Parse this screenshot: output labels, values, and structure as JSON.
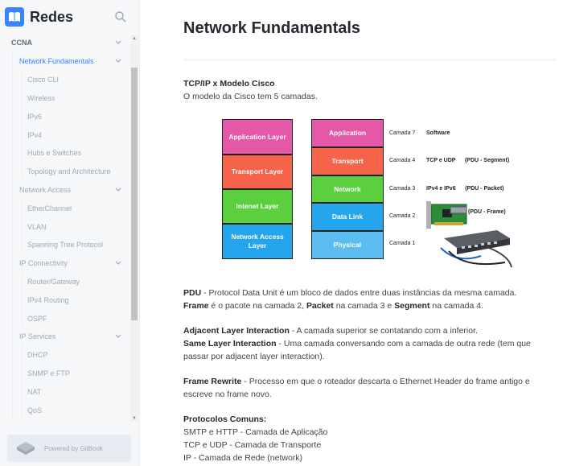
{
  "app": {
    "title": "Redes",
    "logo_icon": "book-icon",
    "accent": "#3884ff"
  },
  "sidebar": {
    "sections": [
      {
        "label": "CCNA",
        "level": 0
      },
      {
        "label": "Network Fundamentals",
        "level": 1,
        "active": true
      },
      {
        "label": "Cisco CLI",
        "level": 2
      },
      {
        "label": "Wireless",
        "level": 2
      },
      {
        "label": "IPv6",
        "level": 2
      },
      {
        "label": "IPv4",
        "level": 2
      },
      {
        "label": "Hubs e Switches",
        "level": 2
      },
      {
        "label": "Topology and Architecture",
        "level": 2
      },
      {
        "label": "Network Access",
        "level": 1
      },
      {
        "label": "EtherChannel",
        "level": 2
      },
      {
        "label": "VLAN",
        "level": 2
      },
      {
        "label": "Spanning Tree Protocol",
        "level": 2
      },
      {
        "label": "IP Connectivity",
        "level": 1
      },
      {
        "label": "Router/Gateway",
        "level": 2
      },
      {
        "label": "IPv4 Routing",
        "level": 2
      },
      {
        "label": "OSPF",
        "level": 2
      },
      {
        "label": "IP Services",
        "level": 1
      },
      {
        "label": "DHCP",
        "level": 2
      },
      {
        "label": "SNMP e FTP",
        "level": 2
      },
      {
        "label": "NAT",
        "level": 2
      },
      {
        "label": "QoS",
        "level": 2
      }
    ],
    "powered_by": "Powered by GitBook"
  },
  "main": {
    "title": "Network Fundamentals",
    "heading": "TCP/IP x Modelo Cisco",
    "intro": "O modelo da Cisco tem 5 camadas.",
    "diagram": {
      "tcpip_layers": [
        {
          "label": "Application Layer",
          "color": "#e557a7"
        },
        {
          "label": "Transport Layer",
          "color": "#f5634a"
        },
        {
          "label": "Intenet Layer",
          "color": "#5ccf3e"
        },
        {
          "label": "Network Access Layer",
          "color": "#25a5ec"
        }
      ],
      "cisco_layers": [
        {
          "label": "Application",
          "color": "#e557a7",
          "camada": "Camada 7",
          "desc": "Software"
        },
        {
          "label": "Transport",
          "color": "#f5634a",
          "camada": "Camada 4",
          "desc": "TCP e UDP      (PDU - Segment)"
        },
        {
          "label": "Network",
          "color": "#5ccf3e",
          "camada": "Camada 3",
          "desc": "IPv4 e IPv6      (PDU - Packet)"
        },
        {
          "label": "Data Link",
          "color": "#25a5ec",
          "camada": "Camada 2",
          "desc": "(PDU - Frame)"
        },
        {
          "label": "Physical",
          "color": "#5bbcf0",
          "camada": "Camada 1",
          "desc": ""
        }
      ]
    },
    "pdu": {
      "term": "PDU",
      "text": " - Protocol Data Unit é um bloco de dados entre duas instâncias da mesma camada."
    },
    "frame_line": {
      "t1": "Frame",
      "m1": " é o pacote na camada 2, ",
      "t2": "Packet",
      "m2": " na camada 3 e ",
      "t3": "Segment",
      "m3": " na camada 4."
    },
    "adjacent": {
      "term": "Adjacent Layer Interaction",
      "text": " - A camada superior se contatando com a inferior."
    },
    "same_layer": {
      "term": "Same Layer Interaction",
      "text": " - Uma camada conversando com a camada de outra rede (tem que passar por adjacent layer interaction)."
    },
    "frame_rewrite": {
      "term": "Frame Rewrite",
      "text": " - Processo em que o roteador descarta o Ethernet Header do frame antigo e escreve no frame novo."
    },
    "protocols": {
      "heading": "Protocolos Comuns:",
      "items": [
        "SMTP e HTTP - Camada de Aplicação",
        "TCP e UDP - Camada de Transporte",
        "IP - Camada de Rede (network)"
      ]
    }
  }
}
